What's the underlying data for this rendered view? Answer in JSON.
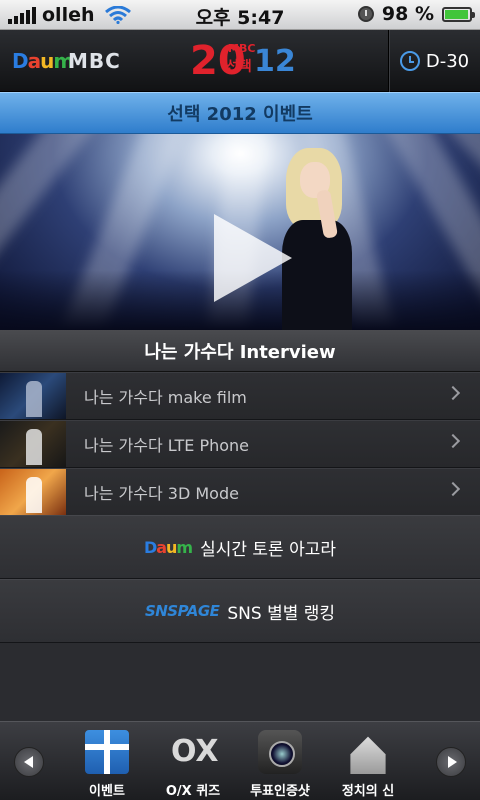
{
  "status": {
    "carrier": "olleh",
    "time": "오후 5:47",
    "battery": "98 %",
    "battery_level": 0.98
  },
  "header": {
    "daum_logo": "Daum",
    "mbc_logo": "MBC",
    "center_logo_20": "20",
    "center_logo_mbc": "MBC",
    "center_logo_seontaek": "선택",
    "center_logo_12": "12",
    "dday": "D-30"
  },
  "event_title": "선택 2012 이벤트",
  "interview": {
    "title": "나는 가수다 Interview",
    "items": [
      {
        "label": "나는 가수다 make film"
      },
      {
        "label": "나는 가수다 LTE Phone"
      },
      {
        "label": "나는 가수다 3D Mode"
      }
    ]
  },
  "promos": [
    {
      "logo": "Daum",
      "label": "실시간 토론 아고라"
    },
    {
      "logo": "SNSPAGE",
      "label": "SNS 별별 랭킹"
    }
  ],
  "tabs": [
    {
      "label": "이벤트",
      "icon": "gift-icon"
    },
    {
      "label": "O/X 퀴즈",
      "icon": "ox-quiz-icon"
    },
    {
      "label": "투표인증샷",
      "icon": "camera-icon"
    },
    {
      "label": "정치의 신",
      "icon": "assembly-building-icon"
    }
  ],
  "colors": {
    "accent_blue": "#2f7dcc",
    "daum_d": "#2a7de1",
    "daum_a": "#e8422f",
    "daum_u": "#f2b824",
    "daum_m": "#35b34a",
    "brand_red": "#e0222c"
  }
}
